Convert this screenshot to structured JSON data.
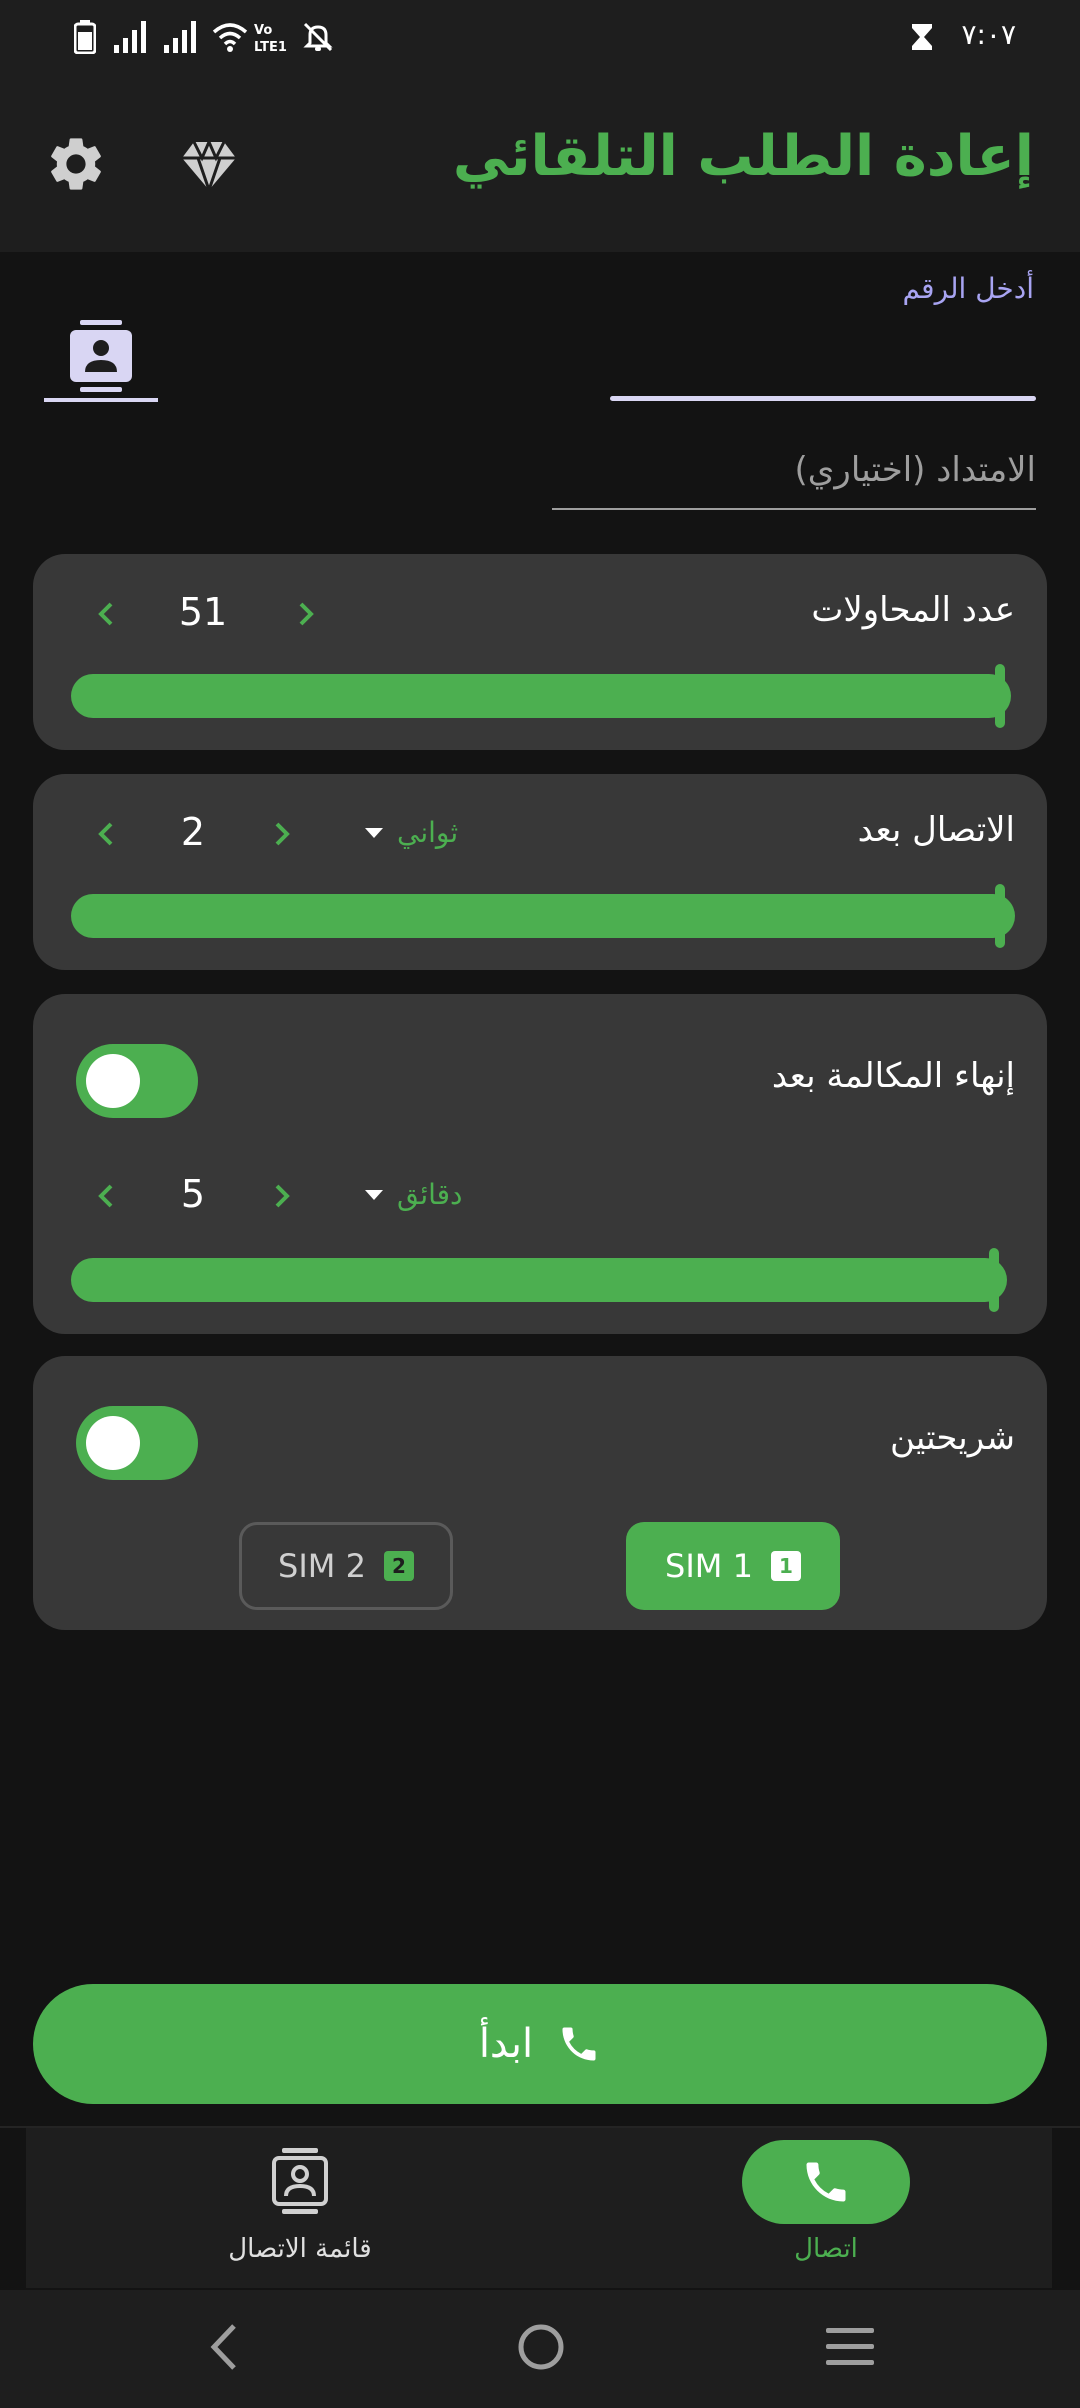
{
  "status_bar": {
    "time": "٧:٠٧"
  },
  "app_bar": {
    "title": "إعادة الطلب التلقائي",
    "settings_icon": "gear-icon",
    "premium_icon": "diamond-icon"
  },
  "inputs": {
    "number_label": "أدخل الرقم",
    "number_value": "",
    "extension_placeholder": "الامتداد (اختياري)"
  },
  "attempts": {
    "label": "عدد المحاولات",
    "value": "51",
    "slider_fraction": 1.0
  },
  "call_after": {
    "label": "الاتصال بعد",
    "value": "2",
    "unit": "ثواني",
    "slider_fraction": 1.0
  },
  "end_call": {
    "label": "إنهاء المكالمة بعد",
    "enabled": true,
    "value": "5",
    "unit": "دقائق",
    "slider_fraction": 1.0
  },
  "dual_sim": {
    "label": "شريحتين",
    "enabled": true,
    "sim1_label": "SIM 1",
    "sim1_badge": "1",
    "sim2_label": "SIM 2",
    "sim2_badge": "2",
    "selected": "SIM 1"
  },
  "start_button": {
    "label": "ابدأ"
  },
  "bottom_nav": {
    "call_label": "اتصال",
    "contacts_label": "قائمة الاتصال",
    "active": "call"
  },
  "colors": {
    "accent": "#4caf50",
    "card": "#383838",
    "background": "#131313",
    "bar": "#1e1e1e",
    "label_purple": "#a8a4f2"
  }
}
